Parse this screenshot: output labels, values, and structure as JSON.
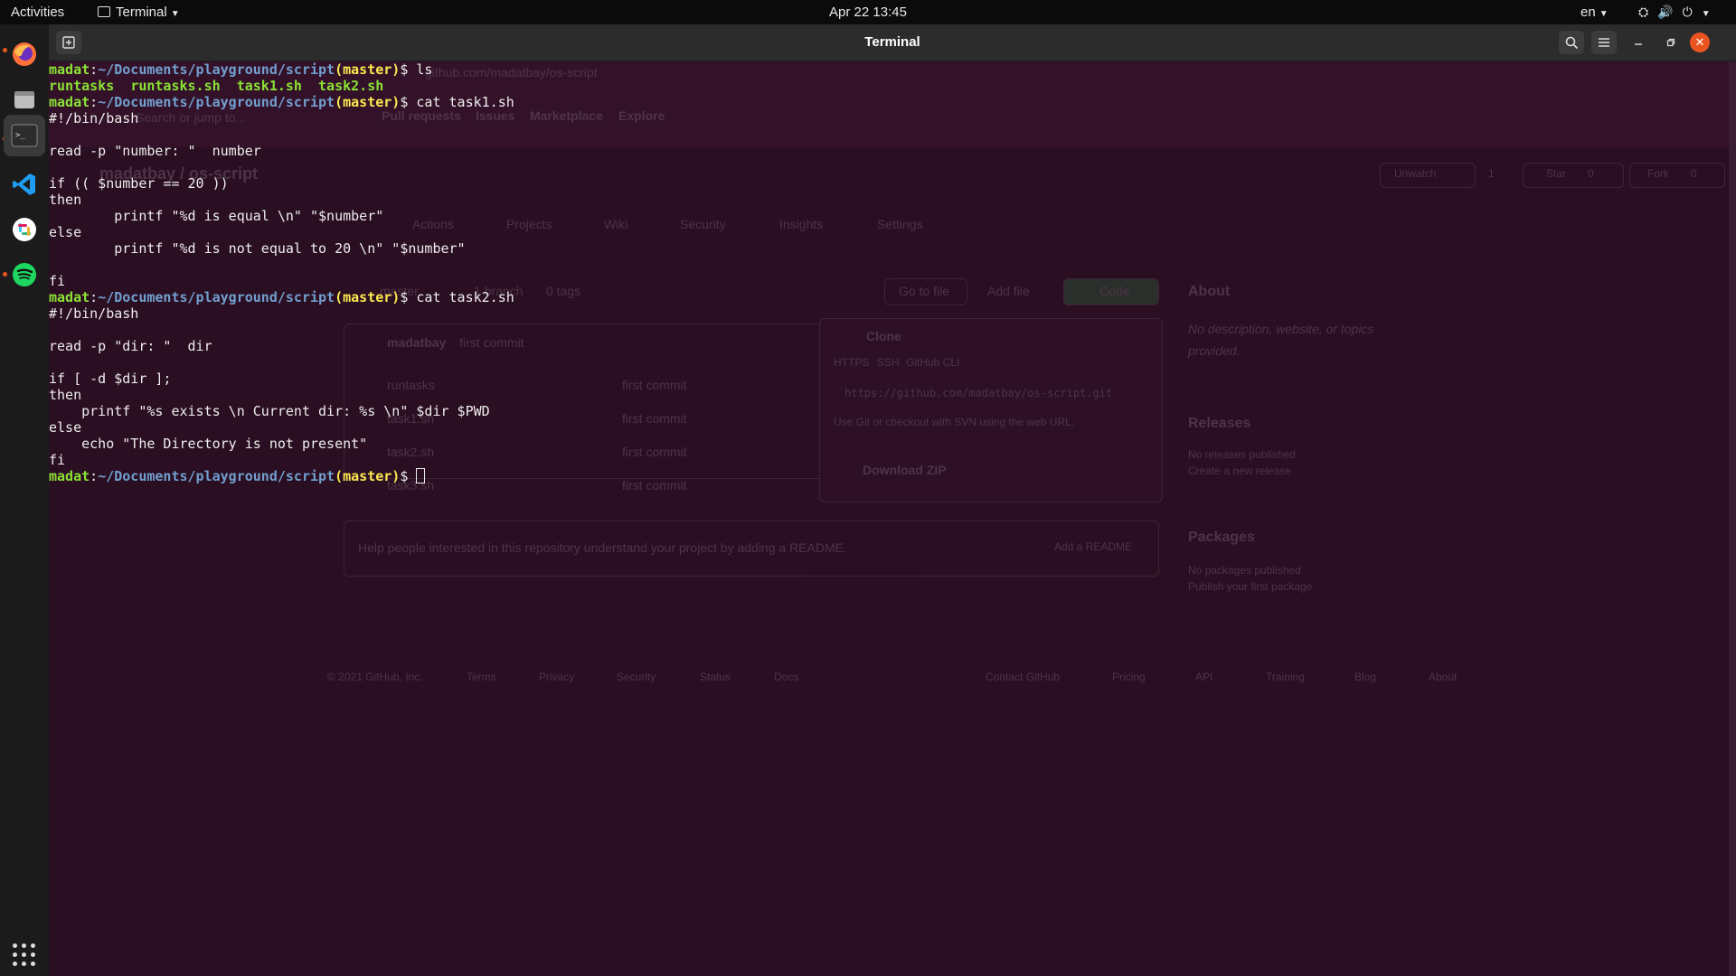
{
  "topbar": {
    "activities": "Activities",
    "app_name": "Terminal",
    "clock": "Apr 22  13:45",
    "lang": "en"
  },
  "window": {
    "title": "Terminal"
  },
  "prompt": {
    "user": "madat",
    "path": "~/Documents/playground/script",
    "branch": "(master)",
    "symbol": "$ "
  },
  "terminal": {
    "cmd1": "ls",
    "ls_output": [
      "runtasks",
      "runtasks.sh",
      "task1.sh",
      "task2.sh"
    ],
    "cmd2": "cat task1.sh",
    "task1": [
      "#!/bin/bash",
      "",
      "read -p \"number: \"  number",
      "",
      "if (( $number == 20 ))",
      "then",
      "        printf \"%d is equal \\n\" \"$number\"",
      "else",
      "        printf \"%d is not equal to 20 \\n\" \"$number\"",
      "",
      "fi"
    ],
    "cmd3": "cat task2.sh",
    "task2": [
      "#!/bin/bash",
      "",
      "read -p \"dir: \"  dir",
      "",
      "if [ -d $dir ];",
      "then",
      "    printf \"%s exists \\n Current dir: %s \\n\" $dir $PWD",
      "else",
      "    echo \"The Directory is not present\"",
      "fi"
    ]
  },
  "ghost": {
    "url": "github.com/madatbay/os-script",
    "search": "Search or jump to...",
    "nav": [
      "Pull requests",
      "Issues",
      "Marketplace",
      "Explore"
    ],
    "repo": "madatbay / os-script",
    "unwatch": "Unwatch",
    "unwatch_count": "1",
    "star": "Star",
    "star_count": "0",
    "fork": "Fork",
    "fork_count": "0",
    "tabs": [
      "Actions",
      "Projects",
      "Wiki",
      "Security",
      "Insights",
      "Settings"
    ],
    "branch": "master",
    "branches": "1 branch",
    "tags": "0 tags",
    "go_to_file": "Go to file",
    "add_file": "Add file",
    "code": "Code",
    "commit_user": "madatbay",
    "commit_msg": "first commit",
    "files": [
      "runtasks",
      "task1.sh",
      "task2.sh",
      "task3.sh"
    ],
    "file_commit": "first commit",
    "clone": "Clone",
    "clone_tabs": [
      "HTTPS",
      "SSH",
      "GitHub CLI"
    ],
    "clone_url": "https://github.com/madatbay/os-script.git",
    "clone_hint": "Use Git or checkout with SVN using the web URL.",
    "download_zip": "Download ZIP",
    "readme_hint": "Help people interested in this repository understand your project by adding a README.",
    "add_readme": "Add a README",
    "about": "About",
    "about_text": "No description, website, or topics provided.",
    "releases": "Releases",
    "no_releases": "No releases published",
    "create_release": "Create a new release",
    "packages": "Packages",
    "no_packages": "No packages published",
    "publish_package": "Publish your first package",
    "footer": [
      "© 2021 GitHub, Inc.",
      "Terms",
      "Privacy",
      "Security",
      "Status",
      "Docs",
      "Contact GitHub",
      "Pricing",
      "API",
      "Training",
      "Blog",
      "About"
    ]
  }
}
